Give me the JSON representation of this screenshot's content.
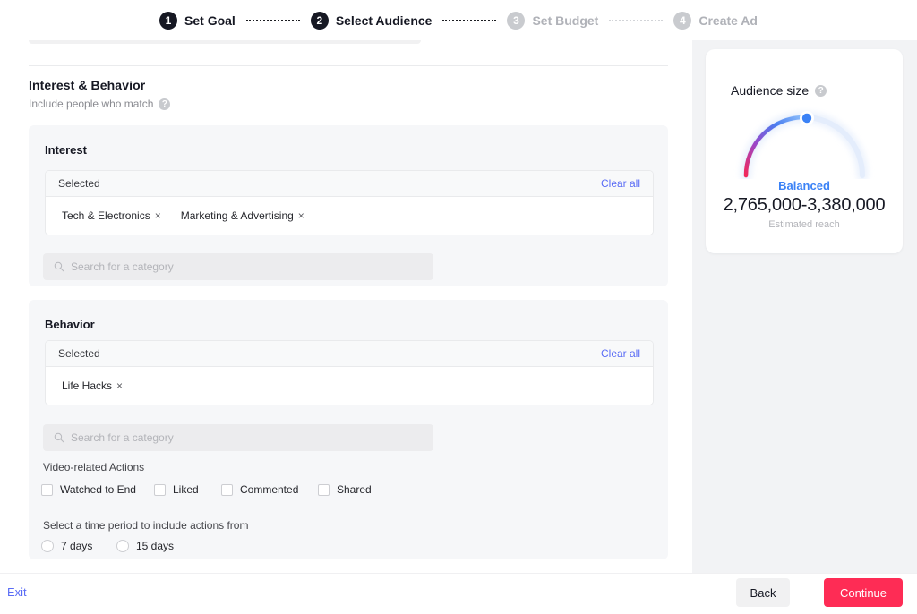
{
  "stepper": {
    "steps": [
      {
        "num": "1",
        "label": "Set Goal",
        "state": "active"
      },
      {
        "num": "2",
        "label": "Select Audience",
        "state": "active"
      },
      {
        "num": "3",
        "label": "Set Budget",
        "state": "inactive"
      },
      {
        "num": "4",
        "label": "Create Ad",
        "state": "inactive"
      }
    ]
  },
  "section": {
    "title": "Interest & Behavior",
    "subtitle": "Include people who match",
    "help_icon": "help-circle-icon"
  },
  "interest": {
    "card_title": "Interest",
    "selected_label": "Selected",
    "clear_all": "Clear all",
    "tags": [
      {
        "label": "Tech & Electronics",
        "remove": "×"
      },
      {
        "label": "Marketing & Advertising",
        "remove": "×"
      }
    ],
    "search_placeholder": "Search for a category",
    "search_value": "",
    "search_icon": "search-icon"
  },
  "behavior": {
    "card_title": "Behavior",
    "selected_label": "Selected",
    "clear_all": "Clear all",
    "tags": [
      {
        "label": "Life Hacks",
        "remove": "×"
      }
    ],
    "search_placeholder": "Search for a category",
    "search_value": "",
    "search_icon": "search-icon",
    "video_actions_label": "Video-related Actions",
    "video_actions": [
      {
        "label": "Watched to End",
        "checked": false
      },
      {
        "label": "Liked",
        "checked": false
      },
      {
        "label": "Commented",
        "checked": false
      },
      {
        "label": "Shared",
        "checked": false
      }
    ],
    "time_period_label": "Select a time period to include actions from",
    "time_periods": [
      {
        "label": "7 days",
        "selected": false
      },
      {
        "label": "15 days",
        "selected": false
      }
    ]
  },
  "audience": {
    "title": "Audience size",
    "help_icon": "help-circle-icon",
    "status": "Balanced",
    "value": "2,765,000-3,380,000",
    "caption": "Estimated reach",
    "gauge": {
      "fill_fraction": 0.5,
      "track_color": "#e8eefb",
      "gradient_start": "#f2295b",
      "gradient_mid": "#7b5ae0",
      "gradient_end": "#3b82f6",
      "marker_color": "#3b82f6"
    }
  },
  "footer": {
    "exit": "Exit",
    "back": "Back",
    "continue": "Continue",
    "continue_color": "#fe2c55"
  }
}
